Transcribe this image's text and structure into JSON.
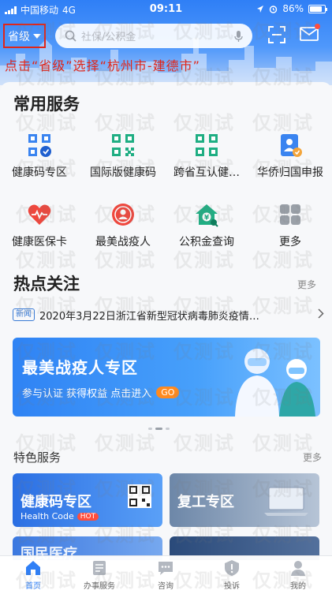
{
  "status_bar": {
    "carrier": "中国移动",
    "network": "4G",
    "time": "09:11",
    "battery": "86%",
    "battery_level": 0.86
  },
  "header": {
    "province_label": "省级",
    "search_placeholder": "社保/公积金",
    "annotation": "点击“省级”选择“杭州市-建德市”"
  },
  "common_services": {
    "title": "常用服务",
    "items": [
      {
        "label": "健康码专区",
        "icon": "health-code-icon"
      },
      {
        "label": "国际版健康码",
        "icon": "qr-code-icon"
      },
      {
        "label": "跨省互认健…",
        "icon": "cross-province-qr-icon"
      },
      {
        "label": "华侨归国申报",
        "icon": "overseas-return-icon"
      },
      {
        "label": "健康医保卡",
        "icon": "medical-heart-icon"
      },
      {
        "label": "最美战疫人",
        "icon": "hero-award-icon"
      },
      {
        "label": "公积金查询",
        "icon": "housing-fund-icon"
      },
      {
        "label": "更多",
        "icon": "more-grid-icon"
      }
    ]
  },
  "hot_focus": {
    "title": "热点关注",
    "more": "更多",
    "news_tag": "新闻",
    "news_text": "2020年3月22日浙江省新型冠状病毒肺炎疫情…"
  },
  "banner": {
    "title": "最美战疫人专区",
    "subtitle": "参与认证  获得权益  点击进入",
    "go": "GO"
  },
  "featured": {
    "title": "特色服务",
    "more": "更多",
    "cards": [
      {
        "title": "健康码专区",
        "subtitle": "Health Code",
        "badge": "HOT"
      },
      {
        "title": "复工专区"
      },
      {
        "title": "国民医疗"
      }
    ]
  },
  "tabbar": {
    "items": [
      {
        "label": "首页",
        "icon": "home-icon",
        "active": true
      },
      {
        "label": "办事服务",
        "icon": "service-icon",
        "active": false
      },
      {
        "label": "咨询",
        "icon": "consult-icon",
        "active": false
      },
      {
        "label": "投诉",
        "icon": "complaint-icon",
        "active": false
      },
      {
        "label": "我的",
        "icon": "profile-icon",
        "active": false
      }
    ]
  },
  "watermark": "仅测试",
  "colors": {
    "primary": "#2f7ff6",
    "annotation_red": "#e0261a",
    "go_orange": "#ff8a1f"
  }
}
